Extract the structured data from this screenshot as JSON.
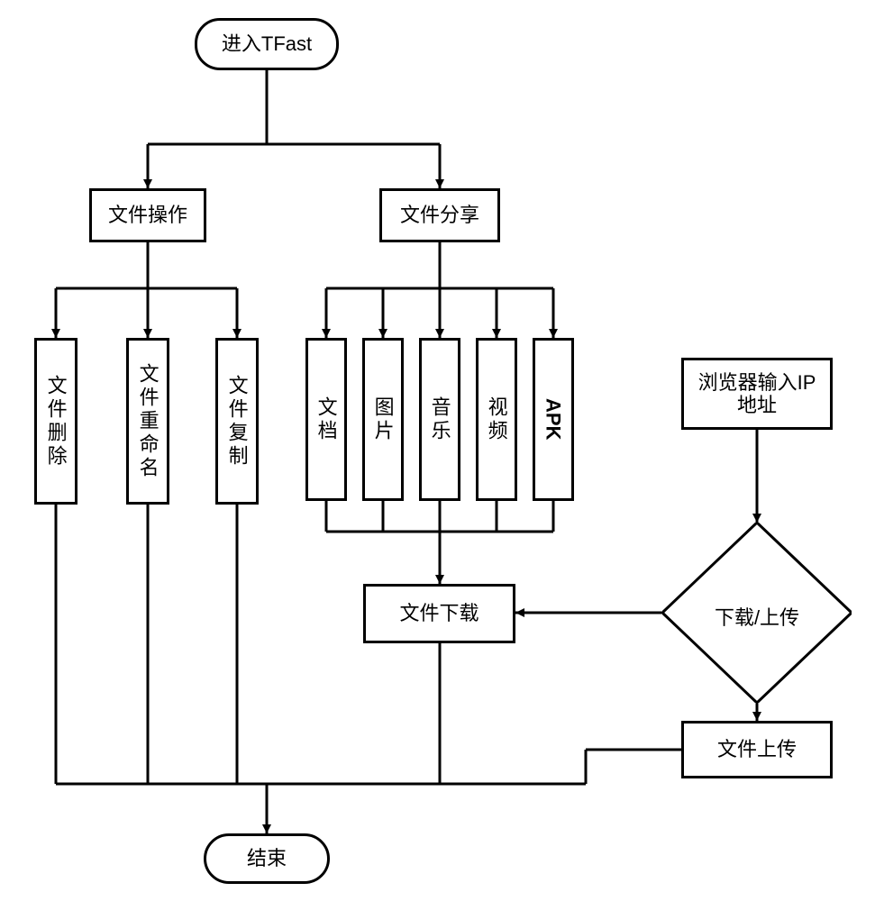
{
  "chart_data": {
    "type": "flowchart",
    "nodes": [
      {
        "id": "start",
        "shape": "terminator",
        "label": "进入TFast"
      },
      {
        "id": "file_ops",
        "shape": "process",
        "label": "文件操作"
      },
      {
        "id": "file_share",
        "shape": "process",
        "label": "文件分享"
      },
      {
        "id": "op_delete",
        "shape": "process",
        "label": "文件删除"
      },
      {
        "id": "op_rename",
        "shape": "process",
        "label": "文件重命名"
      },
      {
        "id": "op_copy",
        "shape": "process",
        "label": "文件复制"
      },
      {
        "id": "share_doc",
        "shape": "process",
        "label": "文档"
      },
      {
        "id": "share_img",
        "shape": "process",
        "label": "图片"
      },
      {
        "id": "share_music",
        "shape": "process",
        "label": "音乐"
      },
      {
        "id": "share_video",
        "shape": "process",
        "label": "视频"
      },
      {
        "id": "share_apk",
        "shape": "process",
        "label": "APK"
      },
      {
        "id": "browser_ip",
        "shape": "process",
        "label": "浏览器输入IP地址"
      },
      {
        "id": "download",
        "shape": "process",
        "label": "文件下载"
      },
      {
        "id": "dl_up",
        "shape": "decision",
        "label": "下载/上传"
      },
      {
        "id": "upload",
        "shape": "process",
        "label": "文件上传"
      },
      {
        "id": "end",
        "shape": "terminator",
        "label": "结束"
      }
    ],
    "edges": [
      {
        "from": "start",
        "to": "file_ops"
      },
      {
        "from": "start",
        "to": "file_share"
      },
      {
        "from": "file_ops",
        "to": "op_delete"
      },
      {
        "from": "file_ops",
        "to": "op_rename"
      },
      {
        "from": "file_ops",
        "to": "op_copy"
      },
      {
        "from": "file_share",
        "to": "share_doc"
      },
      {
        "from": "file_share",
        "to": "share_img"
      },
      {
        "from": "file_share",
        "to": "share_music"
      },
      {
        "from": "file_share",
        "to": "share_video"
      },
      {
        "from": "file_share",
        "to": "share_apk"
      },
      {
        "from": "share_doc",
        "to": "download"
      },
      {
        "from": "share_img",
        "to": "download"
      },
      {
        "from": "share_music",
        "to": "download"
      },
      {
        "from": "share_video",
        "to": "download"
      },
      {
        "from": "share_apk",
        "to": "download"
      },
      {
        "from": "browser_ip",
        "to": "dl_up"
      },
      {
        "from": "dl_up",
        "to": "download"
      },
      {
        "from": "dl_up",
        "to": "upload"
      },
      {
        "from": "op_delete",
        "to": "end"
      },
      {
        "from": "op_rename",
        "to": "end"
      },
      {
        "from": "op_copy",
        "to": "end"
      },
      {
        "from": "download",
        "to": "end"
      },
      {
        "from": "upload",
        "to": "end"
      }
    ]
  },
  "nodes": {
    "start": "进入TFast",
    "file_ops": "文件操作",
    "file_share": "文件分享",
    "op_delete": "文件删除",
    "op_rename": "文件重命名",
    "op_copy": "文件复制",
    "share_doc": "文档",
    "share_img": "图片",
    "share_music": "音乐",
    "share_video": "视频",
    "share_apk": "APK",
    "browser_ip_l1": "浏览器输入IP",
    "browser_ip_l2": "地址",
    "download": "文件下载",
    "dl_up": "下载/上传",
    "upload": "文件上传",
    "end": "结束"
  }
}
